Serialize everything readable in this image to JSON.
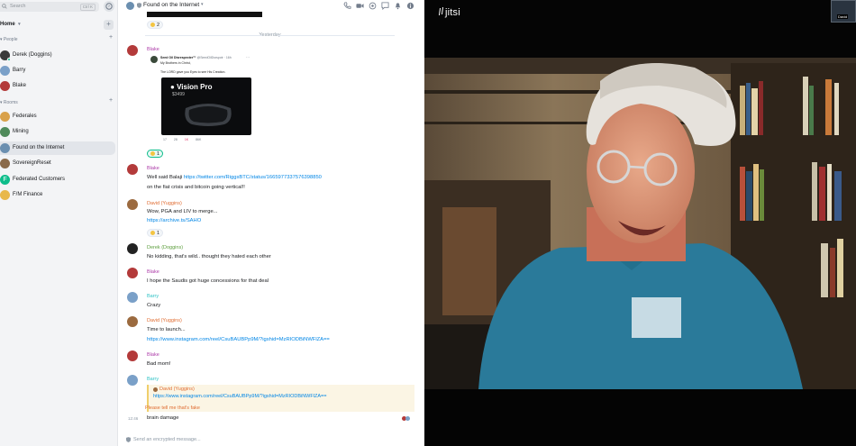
{
  "sidebar": {
    "search_placeholder": "Search",
    "search_shortcut": "Ctrl K",
    "home_label": "Home",
    "people_section": "People",
    "people": [
      {
        "name": "Derek (Doggins)",
        "avatar_color": "#3a3a3a"
      },
      {
        "name": "Barry",
        "avatar_color": "#7aa0c8"
      },
      {
        "name": "Blake",
        "avatar_color": "#b33a3a"
      }
    ],
    "rooms_section": "Rooms",
    "rooms": [
      {
        "name": "Federales",
        "avatar_color": "#d9a14a"
      },
      {
        "name": "Mining",
        "avatar_color": "#4f8a5a"
      },
      {
        "name": "Found on the Internet",
        "avatar_color": "#6b8fb0"
      },
      {
        "name": "SovereignReset",
        "avatar_color": "#8a6a4a"
      },
      {
        "name": "Federated Customers",
        "avatar_color": "#0dbd8b",
        "initial": "F"
      },
      {
        "name": "F/M Finance",
        "avatar_color": "#e8b84a"
      }
    ]
  },
  "room_header": {
    "name": "Found on the Internet"
  },
  "timeline": {
    "top_reaction": "2",
    "date_separator": "Yesterday",
    "tweet": {
      "author": "Seed Oil Disrespecter™",
      "handle": "@SeedOilDsrspctr · 16h",
      "line1": "My Brothers in Christ,",
      "line2": "The LORD gave you Eyes to see His Creation.",
      "image_title": "Vision Pro",
      "image_price": "$3499",
      "stats": [
        "17",
        "28",
        "1K",
        "86K"
      ]
    },
    "messages": [
      {
        "sender": "Blake",
        "color": "#ac3ba8",
        "reaction": "1"
      },
      {
        "sender": "Blake",
        "color": "#ac3ba8",
        "text": "Well said Balaji",
        "link": "https://twitter.com/RiggsBTC/status/1665977337576398850",
        "text2": "on the fiat crisis and bitcoin going vertical!!"
      },
      {
        "sender": "David (Yuggins)",
        "color": "#e06c31",
        "text": "Wow, PGA and LIV to merge...",
        "link": "https://archive.ts/SAHO",
        "reaction": "1"
      },
      {
        "sender": "Derek (Doggins)",
        "color": "#5c9e3c",
        "text": "No kidding, that's wild.. thought they hated each other"
      },
      {
        "sender": "Blake",
        "color": "#ac3ba8",
        "text": "I hope the Saudis got huge concessions for that deal"
      },
      {
        "sender": "Barry",
        "color": "#2dc2c5",
        "text": "Crazy"
      },
      {
        "sender": "David (Yuggins)",
        "color": "#e06c31",
        "text": "Time to launch...",
        "link": "https://www.instagram.com/reel/CsuBAUBPp9M/?igshid=MzRIODBiNWFlZA=="
      },
      {
        "sender": "Blake",
        "color": "#ac3ba8",
        "text": "Bad mom!"
      },
      {
        "sender": "Barry",
        "color": "#2dc2c5",
        "reply_to": "David (Yuggins)",
        "reply_link": "https://www.instagram.com/reel/CsuBAUBPp9M/?igshid=MzRIODBiNWFlZA==",
        "reply_text": "Please tell me that's fake",
        "text": "brain damage",
        "time": "12:46"
      }
    ]
  },
  "composer": {
    "placeholder": "Send an encrypted message..."
  },
  "video": {
    "brand": "jitsi",
    "self_label": "David"
  }
}
